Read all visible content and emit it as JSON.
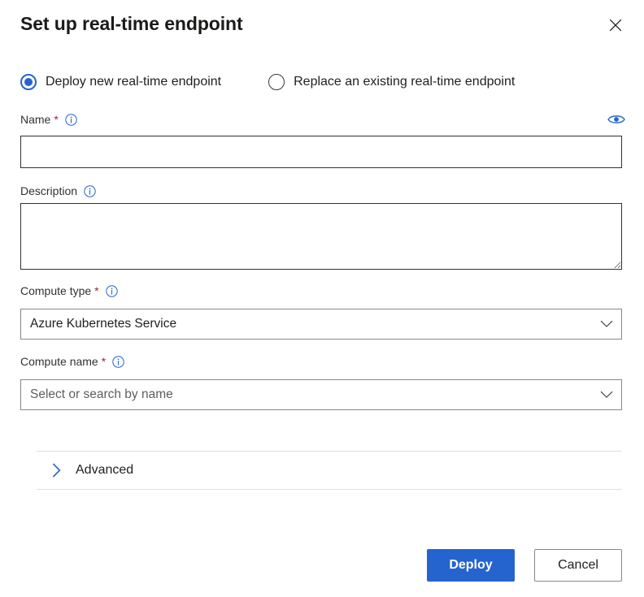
{
  "dialog": {
    "title": "Set up real-time endpoint",
    "close_icon": "close-icon"
  },
  "deployment_mode": {
    "options": [
      {
        "label": "Deploy new real-time endpoint",
        "selected": true
      },
      {
        "label": "Replace an existing real-time endpoint",
        "selected": false
      }
    ]
  },
  "fields": {
    "name": {
      "label": "Name",
      "required_marker": "*",
      "info_icon": "info-icon",
      "visibility_icon": "eye-icon",
      "value": "",
      "placeholder": ""
    },
    "description": {
      "label": "Description",
      "info_icon": "info-icon",
      "value": "",
      "placeholder": ""
    },
    "compute_type": {
      "label": "Compute type",
      "required_marker": "*",
      "info_icon": "info-icon",
      "value": "Azure Kubernetes Service",
      "chevron_icon": "chevron-down-icon"
    },
    "compute_name": {
      "label": "Compute name",
      "required_marker": "*",
      "info_icon": "info-icon",
      "value": "Select or search by name",
      "is_placeholder": true,
      "chevron_icon": "chevron-down-icon"
    }
  },
  "advanced": {
    "label": "Advanced",
    "expanded": false,
    "chevron_icon": "chevron-right-icon"
  },
  "footer": {
    "deploy_label": "Deploy",
    "cancel_label": "Cancel"
  },
  "colors": {
    "accent_blue": "#2564cf",
    "required_red": "#a4262c",
    "text_primary": "#201f1e",
    "border_strong": "#323130",
    "border_soft": "#8a8886",
    "divider": "#e1dfdd"
  }
}
